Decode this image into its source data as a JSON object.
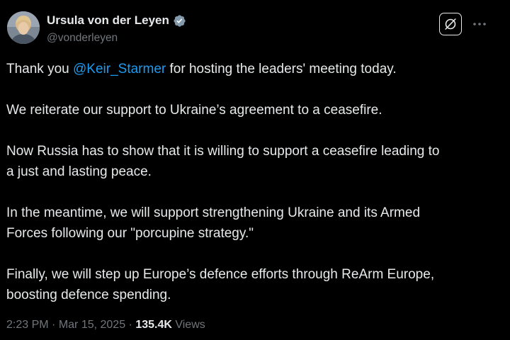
{
  "author": {
    "display_name": "Ursula von der Leyen",
    "handle": "@vonderleyen",
    "verified_badge": "verified-badge-icon",
    "avatar": "profile-photo"
  },
  "header_actions": {
    "grok_icon": "grok-icon",
    "more_icon": "more-dots-icon"
  },
  "tweet": {
    "paragraphs": [
      {
        "before_mention": "Thank you ",
        "mention": "@Keir_Starmer",
        "after_mention": " for hosting the leaders' meeting today."
      },
      {
        "text": "We reiterate our support to Ukraine’s agreement to a ceasefire."
      },
      {
        "line1": "Now Russia has to show that it is willing to support a ceasefire leading to",
        "line2": "a just and lasting peace."
      },
      {
        "line1": "In the meantime, we will support strengthening Ukraine and its Armed",
        "line2": "Forces following our \"porcupine strategy.\""
      },
      {
        "line1": "Finally, we will step up Europe’s defence efforts through ReArm Europe,",
        "line2": "boosting defence spending."
      }
    ]
  },
  "meta": {
    "time": "2:23 PM",
    "separator": " · ",
    "date": "Mar 15, 2025",
    "views_count": "135.4K",
    "views_label": " Views"
  },
  "colors": {
    "background": "#000000",
    "text": "#e7e9ea",
    "secondary": "#71767b",
    "accent": "#1d9bf0"
  }
}
